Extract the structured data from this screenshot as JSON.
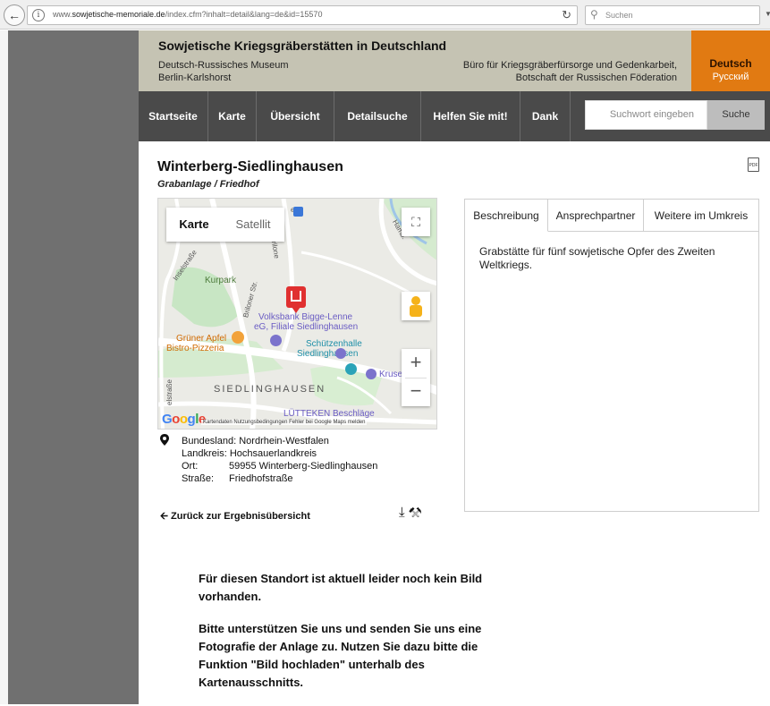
{
  "browser": {
    "url_prefix": "www.",
    "url_domain": "sowjetische-memoriale.de",
    "url_path": "/index.cfm?inhalt=detail&lang=de&id=15570",
    "search_placeholder": "Suchen"
  },
  "header": {
    "title": "Sowjetische Kriegsgräberstätten in Deutschland",
    "subtitle_line1": "Deutsch-Russisches Museum",
    "subtitle_line2": "Berlin-Karlshorst",
    "office_line1": "Büro für Kriegsgräberfürsorge und Gedenkarbeit,",
    "office_line2": "Botschaft der Russischen Föderation",
    "lang_de": "Deutsch",
    "lang_ru": "Русский"
  },
  "nav": {
    "items": [
      "Startseite",
      "Karte",
      "Übersicht",
      "Detailsuche",
      "Helfen Sie mit!",
      "Dank"
    ],
    "search_placeholder": "Suchwort eingeben",
    "search_button": "Suche"
  },
  "page": {
    "title": "Winterberg-Siedlinghausen",
    "subtitle": "Grabanlage / Friedhof"
  },
  "map": {
    "toggle_karte": "Karte",
    "toggle_satellit": "Satellit",
    "labels": {
      "kurpark": "Kurpark",
      "volksbank1": "Volksbank Bigge-Lenne",
      "volksbank2": "eG, Filiale Siedlinghausen",
      "schuetzen1": "Schützenhalle",
      "schuetzen2": "Siedlinghausen",
      "gruener1": "Grüner Apfel",
      "gruener2": "Bistro-Pizzeria",
      "kruse": "Kruse",
      "town": "SIEDLINGHAUSEN",
      "luetteken": "LÜTTEKEN Beschläge",
      "street_left": "elstraße",
      "street_brilon": "Briloner Str.",
      "street_briloner": "Brilone",
      "street_hamb": "Hamb.",
      "street_inselstr": "Inselstraße",
      "street_ende": "en",
      "street_st": "st"
    },
    "google": "Google",
    "footer": "Kartendaten   Nutzungsbedingungen   Fehler bei Google Maps melden"
  },
  "address": {
    "bundesland_label": "Bundesland:",
    "bundesland": "Nordrhein-Westfalen",
    "landkreis_label": "Landkreis:",
    "landkreis": "Hochsauerlandkreis",
    "ort_label": "Ort:",
    "ort": "59955 Winterberg-Siedlinghausen",
    "strasse_label": "Straße:",
    "strasse": "Friedhofstraße"
  },
  "back_link": "Zurück zur Ergebnisübersicht",
  "tabs": {
    "items": [
      "Beschreibung",
      "Ansprechpartner",
      "Weitere im Umkreis"
    ],
    "content": "Grabstätte für fünf sowjetische Opfer des Zweiten Weltkriegs."
  },
  "notice": {
    "p1": "Für diesen Standort ist aktuell leider noch kein Bild vorhanden.",
    "p2": "Bitte unterstützen Sie uns und senden Sie uns eine Fotografie der Anlage zu. Nutzen Sie dazu bitte die Funktion \"Bild hochladen\" unterhalb des Kartenausschnitts."
  },
  "colors": {
    "header_bg": "#c5c3b3",
    "lang_bg": "#e17a12",
    "nav_bg": "#4a4a4a",
    "side_gray": "#707070",
    "map_marker": "#e03030"
  }
}
